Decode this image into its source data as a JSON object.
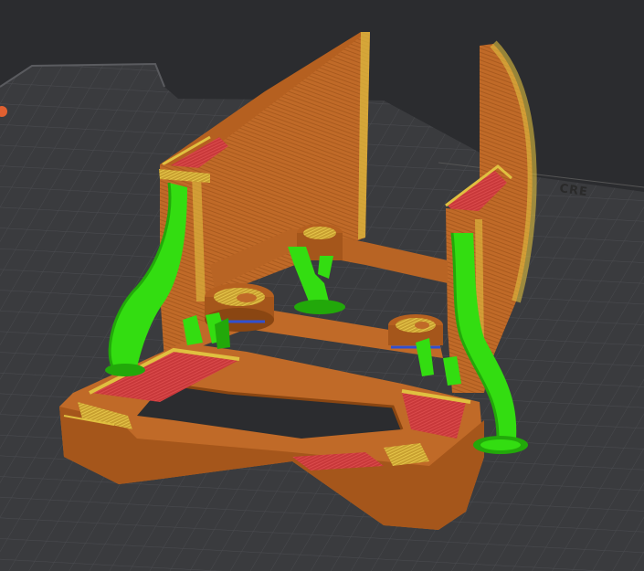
{
  "viewport": {
    "view": "3D preview",
    "bed_logo_text": "CRE",
    "colors": {
      "background": "#2b2c2f",
      "bed": "#3a3b3e",
      "grid_line": "#4a4b4f",
      "wall_outer": "#c06a28",
      "wall_shade": "#a5561b",
      "infill_red": "#c8383a",
      "perimeter_yellow": "#e0c040",
      "support_green": "#33dd11",
      "support_dark": "#22a80a",
      "bridge_blue": "#3050d0"
    },
    "icons": [
      "orange-marker-icon"
    ]
  }
}
